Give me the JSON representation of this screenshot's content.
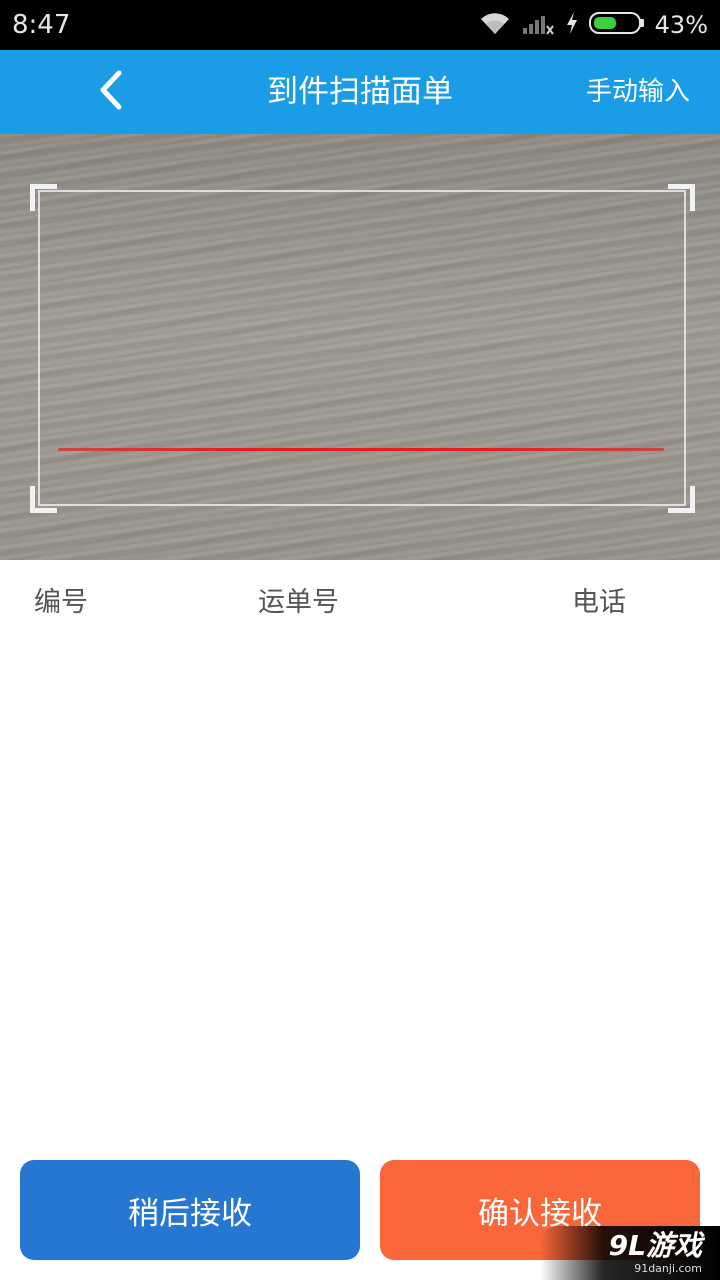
{
  "status_bar": {
    "time": "8:47",
    "battery_percent": "43%",
    "icons": [
      "wifi-icon",
      "signal-icon",
      "charging-icon",
      "battery-icon"
    ]
  },
  "app_bar": {
    "title": "到件扫描面单",
    "back_icon": "chevron-left-icon",
    "manual_input_label": "手动输入",
    "background_color": "#1a9ce6"
  },
  "scanner": {
    "scan_line_color": "#e81c1c"
  },
  "list_header": {
    "columns": [
      "编号",
      "运单号",
      "电话"
    ]
  },
  "actions": {
    "receive_later_label": "稍后接收",
    "confirm_receive_label": "确认接收",
    "receive_later_color": "#2677d2",
    "confirm_receive_color": "#f86639"
  },
  "watermark": {
    "brand": "9L游戏",
    "domain": "91danji.com"
  }
}
